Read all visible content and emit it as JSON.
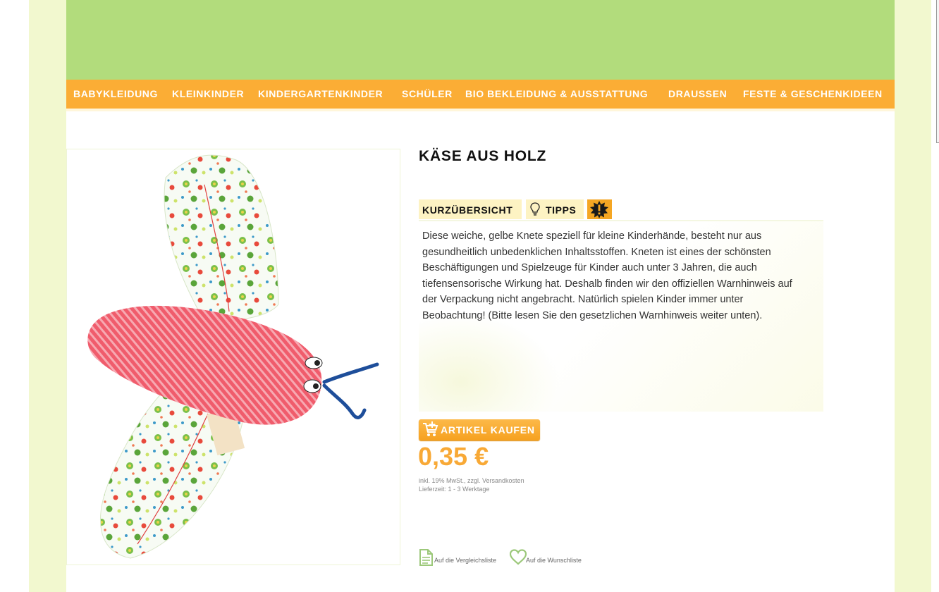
{
  "nav": {
    "items": [
      "BABYKLEIDUNG",
      "KLEINKINDER",
      "KINDERGARTENKINDER",
      "SCHÜLER",
      "BIO BEKLEIDUNG & AUSSTATTUNG",
      "DRAUSSEN",
      "FESTE & GESCHENKIDEEN"
    ]
  },
  "product": {
    "title": "KÄSE AUS HOLZ",
    "image_icon": "fabric-butterfly-toy-image",
    "tabs": [
      {
        "label": "KURZÜBERSICHT",
        "icon": ""
      },
      {
        "label": "TIPPS",
        "icon": "lightbulb-icon"
      },
      {
        "label": "",
        "icon": "warning-burst-icon"
      }
    ],
    "description": "Diese weiche, gelbe Knete speziell für kleine Kinderhände, besteht nur aus gesundheitlich unbedenklichen Inhaltsstoffen. Kneten ist eines der schönsten Beschäftigungen und Spielzeuge für Kinder auch unter 3 Jahren, die auch tiefensensorische Wirkung hat. Deshalb finden wir den offiziellen Warnhinweis auf der Verpackung nicht angebracht. Natürlich spielen Kinder immer unter Beobachtung! (Bitte lesen Sie den gesetzlichen Warnhinweis weiter unten).",
    "buy_button": "ARTIKEL KAUFEN",
    "price": "0,35 €",
    "tax_note": "inkl. 19% MwSt., zzgl. Versandkosten",
    "delivery": "Lieferzeit: 1 - 3 Werktage",
    "compare_link": "Auf die Vergleichsliste",
    "wishlist_link": "Auf die Wunschliste"
  },
  "colors": {
    "banner": "#b2dc7c",
    "nav": "#fbad35",
    "side": "#f2f8cf",
    "price": "#f8a936"
  }
}
